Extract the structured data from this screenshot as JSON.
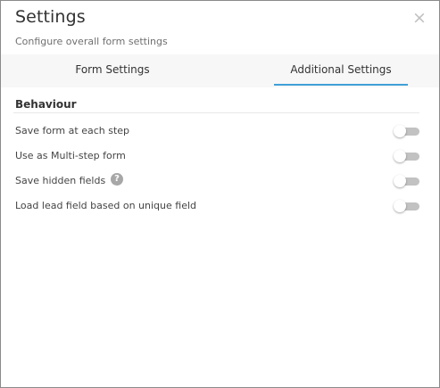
{
  "dialog": {
    "title": "Settings",
    "subtitle": "Configure overall form settings",
    "close_symbol": "×"
  },
  "tabs": [
    {
      "label": "Form Settings",
      "active": false
    },
    {
      "label": "Additional Settings",
      "active": true
    }
  ],
  "section": {
    "title": "Behaviour",
    "rows": [
      {
        "label": "Save form at each step",
        "enabled": false
      },
      {
        "label": "Use as Multi-step form",
        "enabled": false
      },
      {
        "label": "Save hidden fields",
        "enabled": false,
        "help_symbol": "?"
      },
      {
        "label": "Load lead field based on unique field",
        "enabled": false
      }
    ]
  },
  "colors": {
    "accent": "#3f9fd7",
    "toggle_off_track": "#c2c2c2",
    "tab_bar_bg": "#f7f7f7"
  },
  "icons": {
    "close": "close-icon",
    "help": "question-circle-icon"
  }
}
